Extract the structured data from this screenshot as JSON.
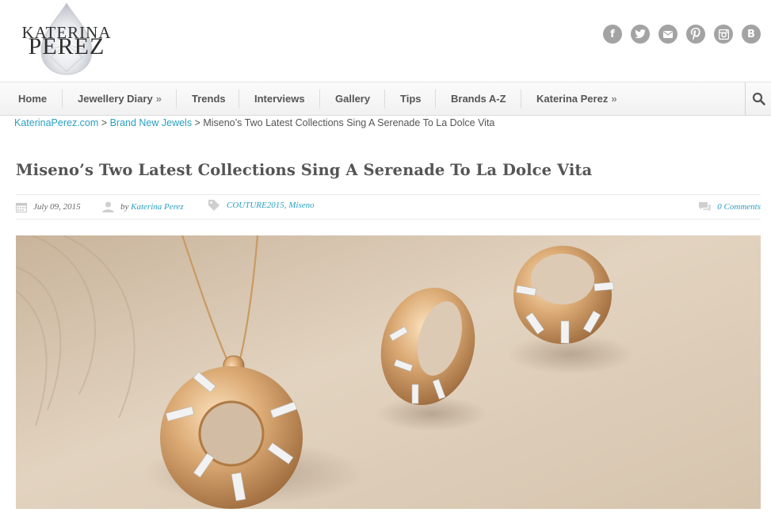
{
  "logo": {
    "line1": "KATERINA",
    "line2": "PEREZ"
  },
  "social": [
    {
      "icon": "facebook-icon",
      "glyph": "f"
    },
    {
      "icon": "twitter-icon",
      "glyph": ""
    },
    {
      "icon": "email-icon",
      "glyph": ""
    },
    {
      "icon": "pinterest-icon",
      "glyph": ""
    },
    {
      "icon": "instagram-icon",
      "glyph": ""
    },
    {
      "icon": "vk-icon",
      "glyph": "B"
    }
  ],
  "nav": {
    "home": "Home",
    "diary": "Jewellery Diary",
    "trends": "Trends",
    "interviews": "Interviews",
    "gallery": "Gallery",
    "tips": "Tips",
    "brands": "Brands A-Z",
    "katerina": "Katerina Perez",
    "raquo": "»"
  },
  "breadcrumb": {
    "home": "KaterinaPerez.com",
    "sep1": " > ",
    "category": "Brand New Jewels",
    "sep2": " > ",
    "current": "Miseno’s Two Latest Collections Sing A Serenade To La Dolce Vita"
  },
  "post": {
    "title": "Miseno’s Two Latest Collections Sing A Serenade To La Dolce Vita",
    "date": "July 09, 2015",
    "by": "by",
    "author": "Katerina Perez",
    "tags": "COUTURE2015, Miseno",
    "comments": "0 Comments"
  },
  "colors": {
    "link": "#2a9fc2",
    "icon_gray": "#a3a3a3",
    "gold": "#d6a571",
    "sand": "#d9c7b1"
  }
}
